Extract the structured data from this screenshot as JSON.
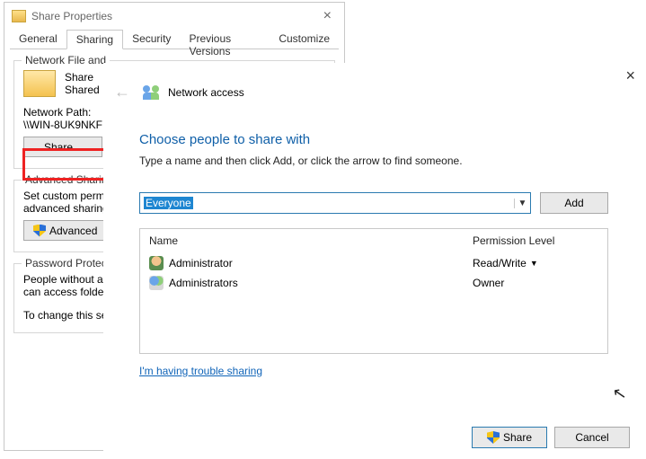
{
  "props": {
    "title": "Share Properties",
    "tabs": [
      "General",
      "Sharing",
      "Security",
      "Previous Versions",
      "Customize"
    ],
    "active_tab": "Sharing",
    "group1": {
      "title": "Network File and",
      "share_name": "Share",
      "share_status": "Shared",
      "path_label": "Network Path:",
      "path_value": "\\\\WIN-8UK9NKF",
      "share_button": "Share..."
    },
    "group2": {
      "title": "Advanced Sharin",
      "desc1": "Set custom permis",
      "desc2": "advanced sharing",
      "adv_button": "Advanced"
    },
    "group3": {
      "title": "Password Protecti",
      "line1": "People without a",
      "line2": "can access folder",
      "line3": "To change this se"
    }
  },
  "net": {
    "breadcrumb": "Network access",
    "heading": "Choose people to share with",
    "subtext": "Type a name and then click Add, or click the arrow to find someone.",
    "input_value": "Everyone",
    "add_button": "Add",
    "columns": {
      "name": "Name",
      "perm": "Permission Level"
    },
    "rows": [
      {
        "icon": "single",
        "name": "Administrator",
        "perm": "Read/Write",
        "has_caret": true
      },
      {
        "icon": "group",
        "name": "Administrators",
        "perm": "Owner",
        "has_caret": false
      }
    ],
    "trouble_link": "I'm having trouble sharing",
    "share_button": "Share",
    "cancel_button": "Cancel"
  }
}
